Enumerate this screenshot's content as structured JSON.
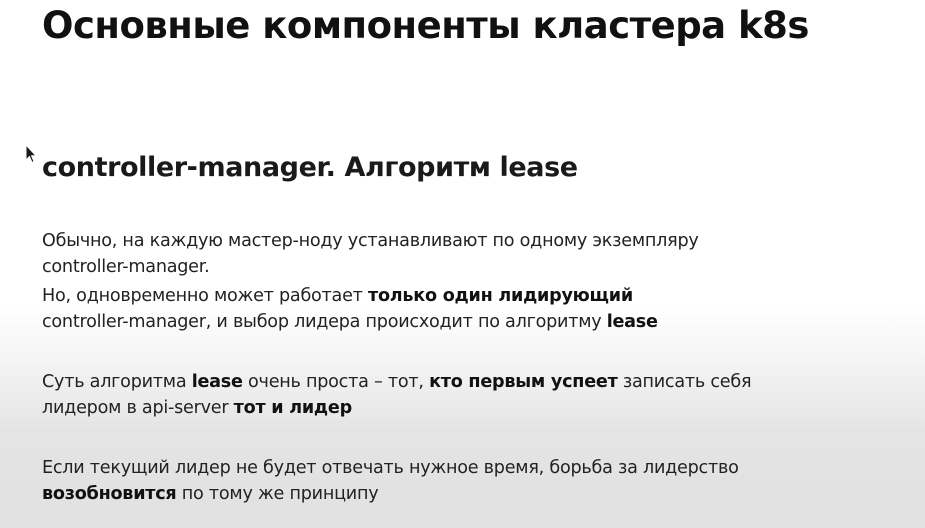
{
  "slide": {
    "title": "Основные компоненты кластера k8s",
    "subtitle": "controller-manager. Алгоритм lease",
    "paragraphs": [
      {
        "line1": "Обычно, на каждую мастер-ноду устанавливают по одному экземпляру",
        "line2": "controller-manager."
      },
      {
        "l1_text": "Но, одновременно может работает ",
        "l1_bold": "только один лидирующий",
        "l2_text": "controller-manager, и выбор лидера происходит по алгоритму ",
        "l2_bold": "lease"
      },
      {
        "l1_text_a": "Суть алгоритма ",
        "l1_bold_a": "lease",
        "l1_text_b": " очень проста – тот, ",
        "l1_bold_b": "кто первым успеет",
        "l1_text_c": " записать себя",
        "l2_text": "лидером в api-server ",
        "l2_bold": "тот и лидер"
      },
      {
        "l1_text": "Если текущий лидер не будет отвечать нужное время, борьба за лидерство",
        "l2_bold": "возобновится",
        "l2_text": " по тому же принципу"
      }
    ]
  },
  "cursor": {
    "icon": "mouse-pointer-icon"
  }
}
